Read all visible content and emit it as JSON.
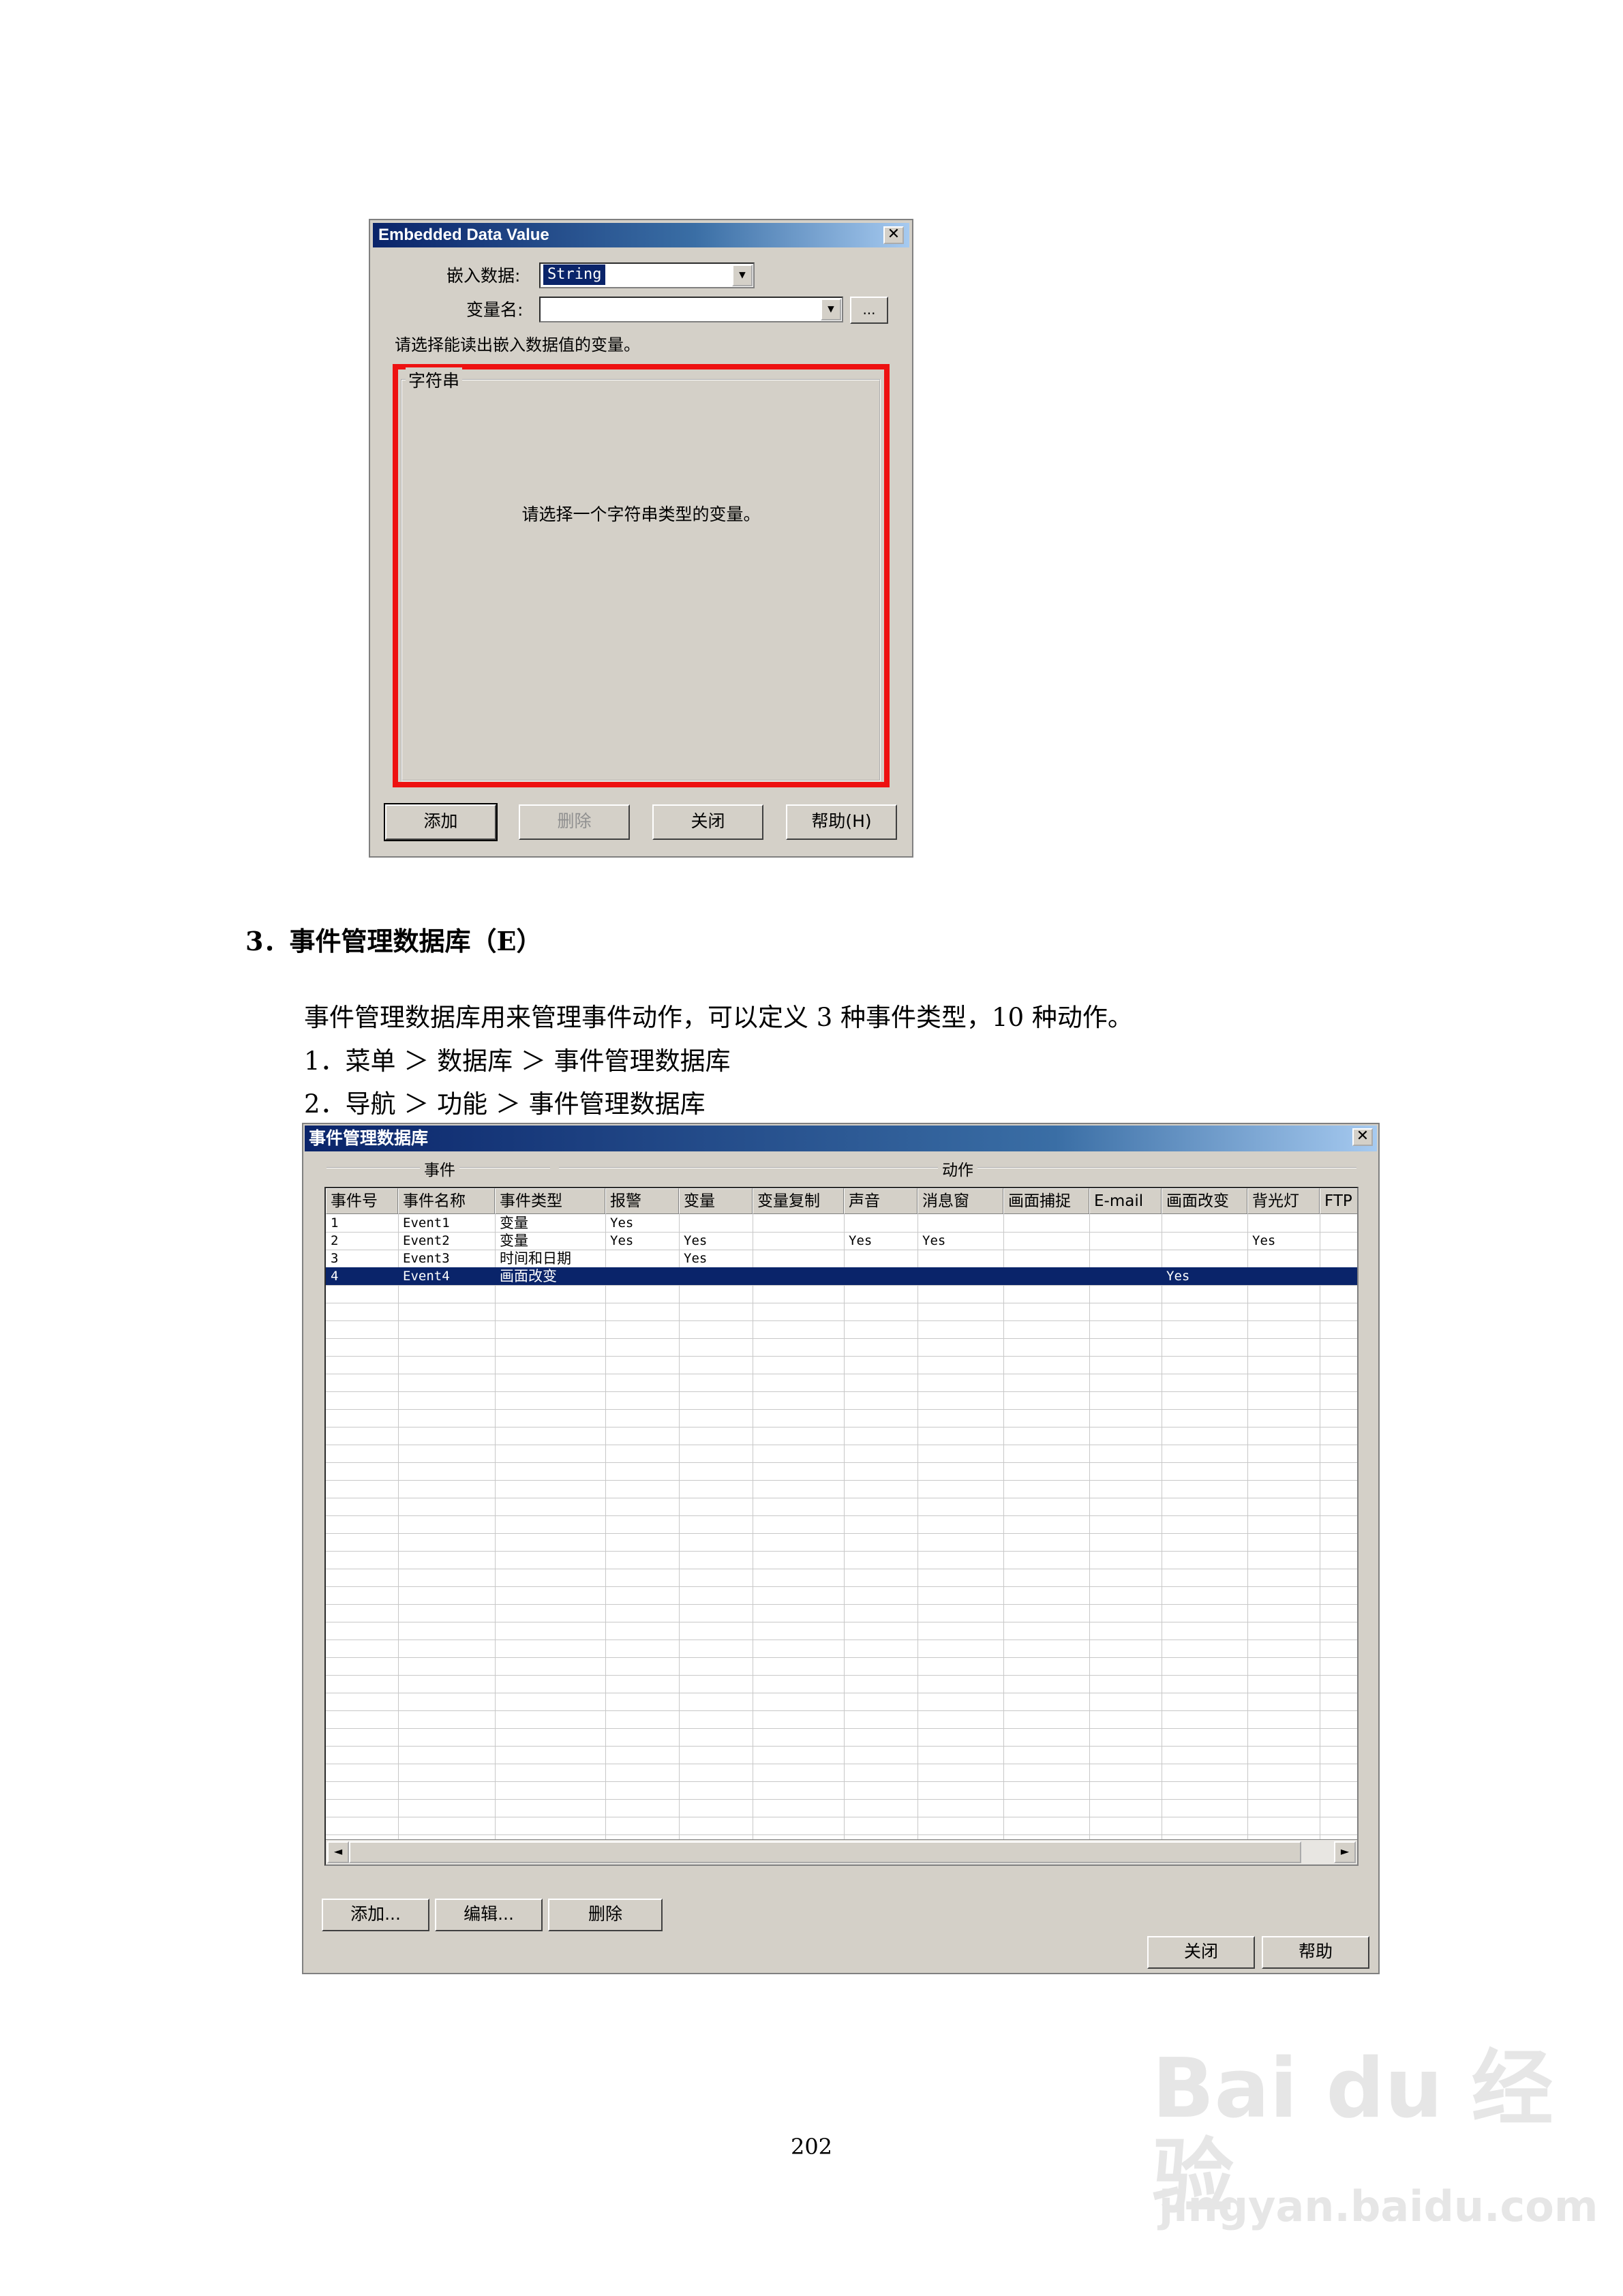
{
  "dialog1": {
    "title": "Embedded Data Value",
    "close_glyph": "✕",
    "embed_label": "嵌入数据:",
    "embed_value": "String",
    "varname_label": "变量名:",
    "varname_value": "",
    "browse_label": "...",
    "hint": "请选择能读出嵌入数据值的变量。",
    "group_title": "字符串",
    "group_message": "请选择一个字符串类型的变量。",
    "buttons": {
      "add": "添加",
      "delete": "删除",
      "close": "关闭",
      "help": "帮助(H)"
    }
  },
  "section": {
    "heading": "3．事件管理数据库（E）",
    "intro": "事件管理数据库用来管理事件动作，可以定义 3 种事件类型，10 种动作。",
    "step1": "1．菜单 ＞ 数据库 ＞ 事件管理数据库",
    "step2": "2．导航 ＞ 功能 ＞ 事件管理数据库"
  },
  "dialog2": {
    "title": "事件管理数据库",
    "close_glyph": "✕",
    "group_event": "事件",
    "group_action": "动作",
    "columns": [
      "事件号",
      "事件名称",
      "事件类型",
      "报警",
      "变量",
      "变量复制",
      "声音",
      "消息窗",
      "画面捕捉",
      "E-mail",
      "画面改变",
      "背光灯",
      "FTP"
    ],
    "rows": [
      [
        "1",
        "Event1",
        "变量",
        "Yes",
        "",
        "",
        "",
        "",
        "",
        "",
        "",
        "",
        ""
      ],
      [
        "2",
        "Event2",
        "变量",
        "Yes",
        "Yes",
        "",
        "Yes",
        "Yes",
        "",
        "",
        "",
        "Yes",
        ""
      ],
      [
        "3",
        "Event3",
        "时间和日期",
        "",
        "Yes",
        "",
        "",
        "",
        "",
        "",
        "",
        "",
        ""
      ],
      [
        "4",
        "Event4",
        "画面改变",
        "",
        "",
        "",
        "",
        "",
        "",
        "",
        "Yes",
        "",
        ""
      ]
    ],
    "selected_row": 3,
    "buttons": {
      "add": "添加...",
      "edit": "编辑...",
      "delete": "删除",
      "close": "关闭",
      "help": "帮助"
    },
    "scroll_left": "◄",
    "scroll_right": "►"
  },
  "page_number": "202",
  "watermark": {
    "brand": "Bai du 经验",
    "url": "jingyan.baidu.com"
  }
}
